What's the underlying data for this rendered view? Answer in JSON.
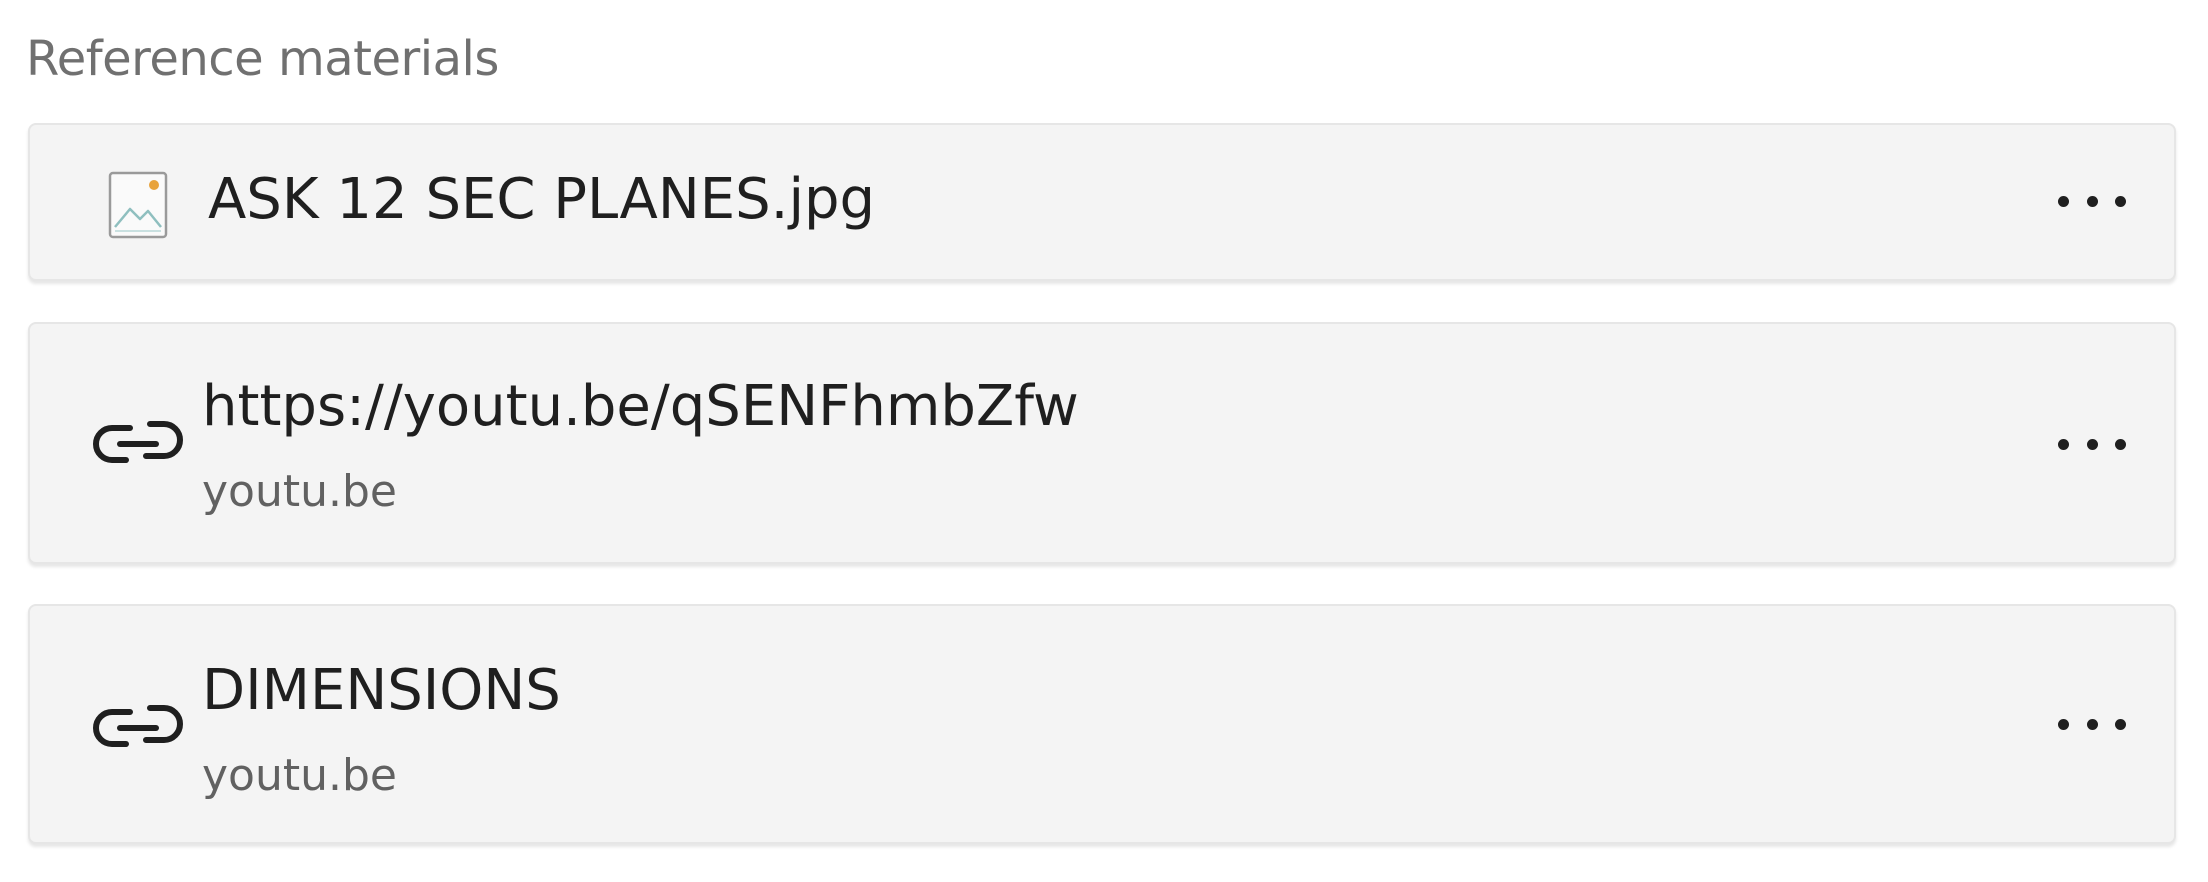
{
  "section": {
    "title": "Reference materials"
  },
  "items": [
    {
      "type": "file",
      "icon": "image-file-icon",
      "title": "ASK 12 SEC PLANES.jpg",
      "more_icon": "more-options-icon"
    },
    {
      "type": "link",
      "icon": "link-icon",
      "title": "https://youtu.be/qSENFhmbZfw",
      "subtitle": "youtu.be",
      "more_icon": "more-options-icon"
    },
    {
      "type": "link",
      "icon": "link-icon",
      "title": "DIMENSIONS",
      "subtitle": "youtu.be",
      "more_icon": "more-options-icon"
    }
  ],
  "colors": {
    "card_background": "#f4f4f4",
    "title_text": "#1f1f1f",
    "subtitle_text": "#616161",
    "section_title_text": "#707070",
    "image_icon_accent": "#e8a33c",
    "image_icon_stroke": "#8fbfbf"
  }
}
